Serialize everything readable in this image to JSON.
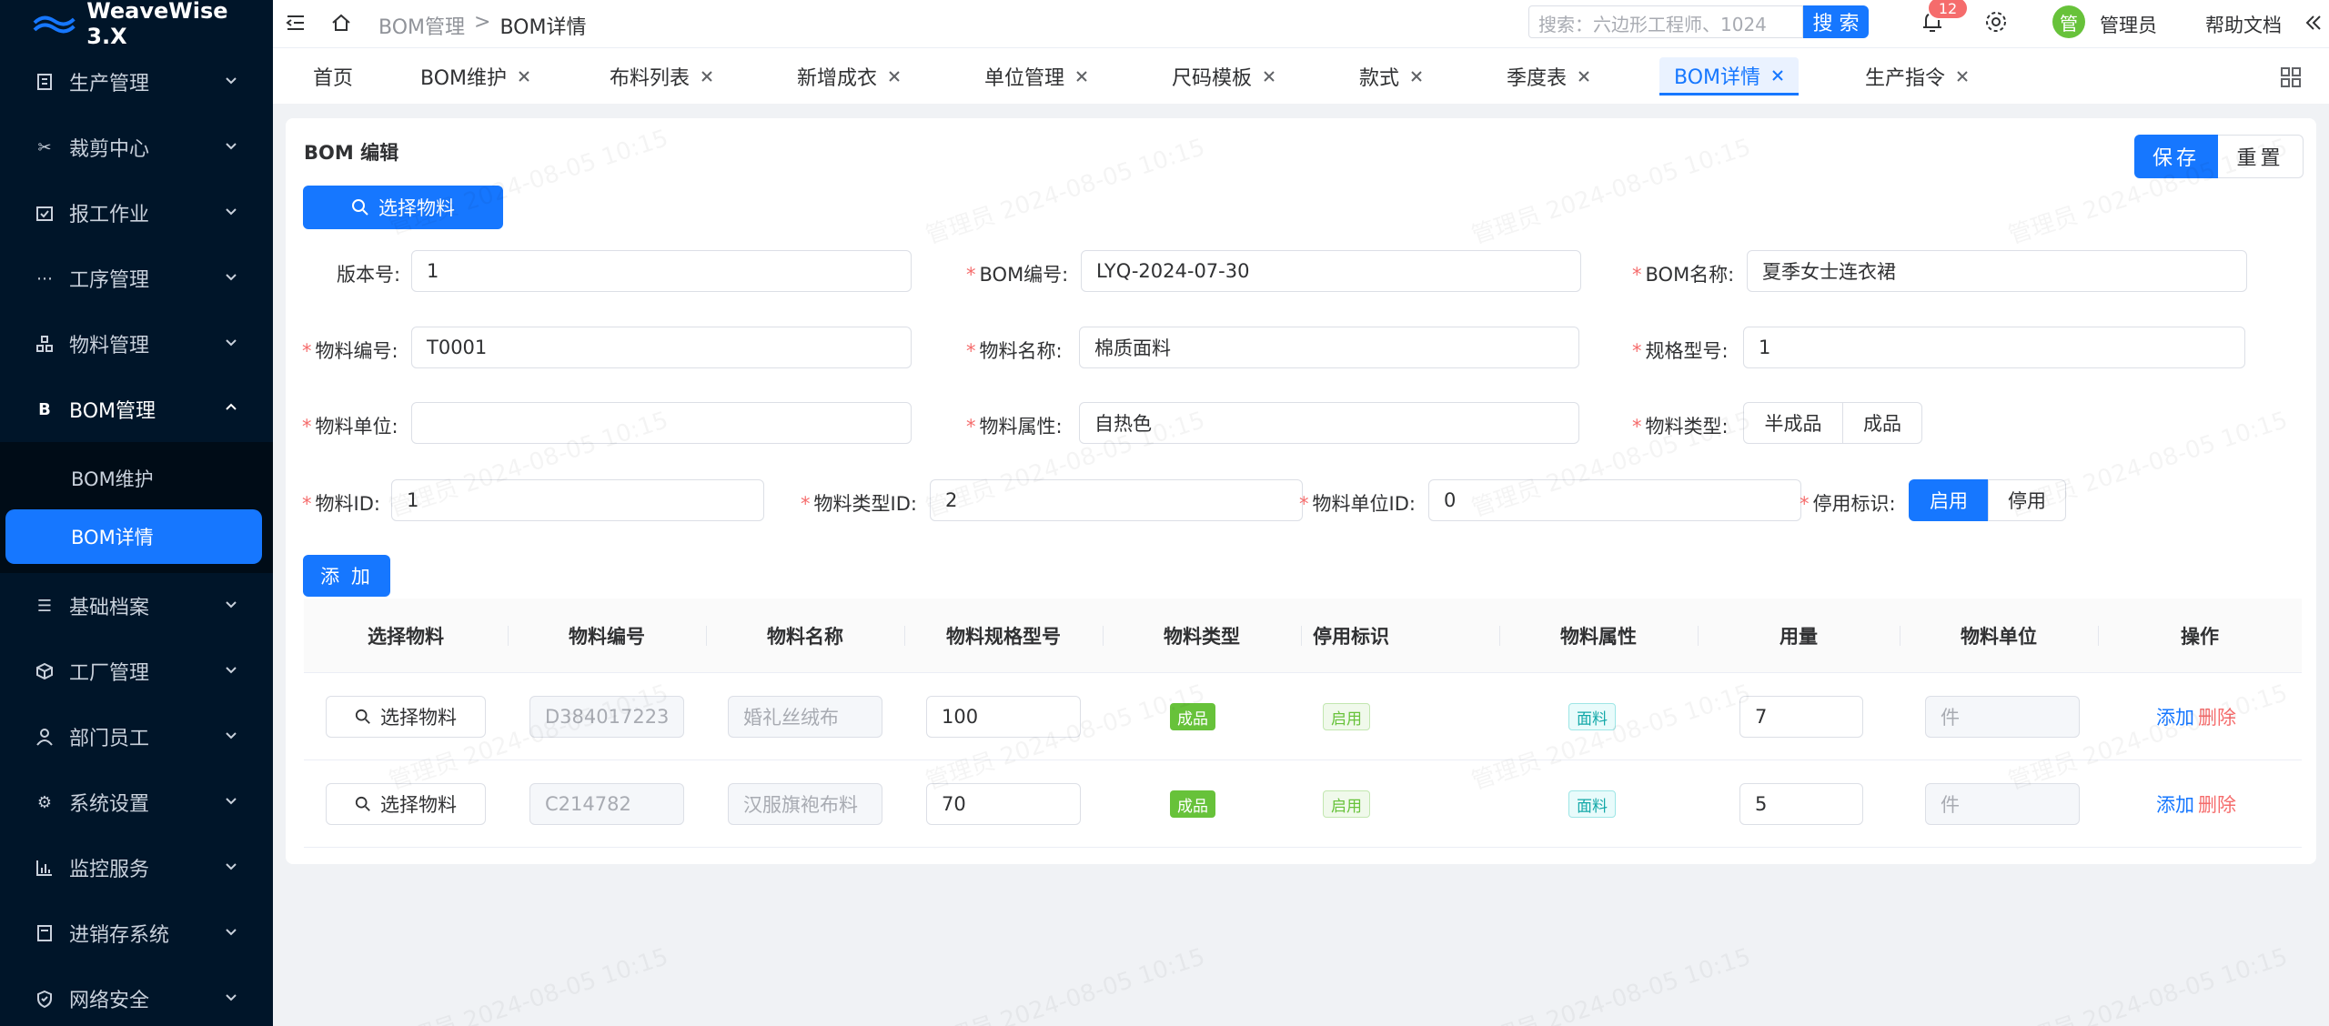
{
  "app": {
    "title": "WeaveWise 3.X"
  },
  "sidebar": {
    "items": [
      {
        "label": "生产管理",
        "icon": "building-icon"
      },
      {
        "label": "裁剪中心",
        "icon": "scissors-icon"
      },
      {
        "label": "报工作业",
        "icon": "calendar-check-icon"
      },
      {
        "label": "工序管理",
        "icon": "ellipsis-icon"
      },
      {
        "label": "物料管理",
        "icon": "boxes-icon"
      },
      {
        "label": "BOM管理",
        "icon": "bold-b-icon"
      },
      {
        "label": "基础档案",
        "icon": "list-icon"
      },
      {
        "label": "工厂管理",
        "icon": "cube-icon"
      },
      {
        "label": "部门员工",
        "icon": "user-icon"
      },
      {
        "label": "系统设置",
        "icon": "gear-icon"
      },
      {
        "label": "监控服务",
        "icon": "bar-chart-icon"
      },
      {
        "label": "进销存系统",
        "icon": "document-icon"
      },
      {
        "label": "网络安全",
        "icon": "shield-icon"
      }
    ],
    "bom_sub": [
      "BOM维护",
      "BOM详情"
    ]
  },
  "header": {
    "breadcrumb": [
      "BOM管理",
      ">",
      "BOM详情"
    ],
    "search_placeholder": "搜索：六边形工程师、1024",
    "search_button": "搜 索",
    "notifications": "12",
    "avatar_text": "管",
    "username": "管理员",
    "help": "帮助文档"
  },
  "tabs": [
    {
      "label": "首页",
      "closable": false
    },
    {
      "label": "BOM维护",
      "closable": true
    },
    {
      "label": "布料列表",
      "closable": true
    },
    {
      "label": "新增成衣",
      "closable": true
    },
    {
      "label": "单位管理",
      "closable": true
    },
    {
      "label": "尺码模板",
      "closable": true
    },
    {
      "label": "款式",
      "closable": true
    },
    {
      "label": "季度表",
      "closable": true
    },
    {
      "label": "BOM详情",
      "closable": true
    },
    {
      "label": "生产指令",
      "closable": true
    }
  ],
  "form": {
    "title": "BOM 编辑",
    "save": "保存",
    "reset": "重置",
    "select_material": "选择物料",
    "add": "添 加",
    "fields": {
      "version": {
        "label": "版本号:",
        "value": "1"
      },
      "bom_code": {
        "label": "BOM编号:",
        "value": "LYQ-2024-07-30"
      },
      "bom_name": {
        "label": "BOM名称:",
        "value": "夏季女士连衣裙"
      },
      "material_code": {
        "label": "物料编号:",
        "value": "T0001"
      },
      "material_name": {
        "label": "物料名称:",
        "value": "棉质面料"
      },
      "spec": {
        "label": "规格型号:",
        "value": "1"
      },
      "unit": {
        "label": "物料单位:",
        "value": ""
      },
      "attr": {
        "label": "物料属性:",
        "value": "自热色"
      },
      "type": {
        "label": "物料类型:",
        "options": [
          "半成品",
          "成品"
        ]
      },
      "material_id": {
        "label": "物料ID:",
        "value": "1"
      },
      "type_id": {
        "label": "物料类型ID:",
        "value": "2"
      },
      "unit_id": {
        "label": "物料单位ID:",
        "value": "0"
      },
      "disable": {
        "label": "停用标识:",
        "options": [
          "启用",
          "停用"
        ],
        "selected": "启用"
      }
    }
  },
  "table": {
    "headers": [
      "选择物料",
      "物料编号",
      "物料名称",
      "物料规格型号",
      "物料类型",
      "停用标识",
      "物料属性",
      "用量",
      "物料单位",
      "操作"
    ],
    "rows": [
      {
        "select": "选择物料",
        "code": "D384017223",
        "name": "婚礼丝绒布",
        "spec": "100",
        "type": "成品",
        "status": "启用",
        "attr": "面料",
        "qty": "7",
        "unit": "件",
        "add": "添加",
        "del": "删除"
      },
      {
        "select": "选择物料",
        "code": "C214782",
        "name": "汉服旗袍布料",
        "spec": "70",
        "type": "成品",
        "status": "启用",
        "attr": "面料",
        "qty": "5",
        "unit": "件",
        "add": "添加",
        "del": "删除"
      }
    ]
  },
  "watermark": "管理员 2024-08-05 10:15",
  "colors": {
    "primary": "#1677ff",
    "sidebar": "#001529",
    "danger": "#f56c6c",
    "success": "#67c23a"
  }
}
